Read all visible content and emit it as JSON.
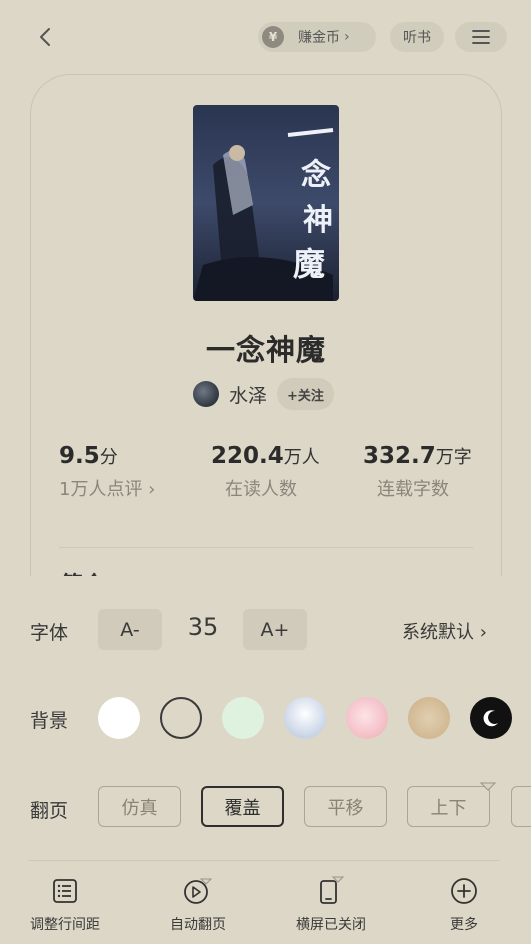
{
  "topbar": {
    "back_icon": "chevron-left-icon",
    "coin_label": "赚金币",
    "coin_chevron": "›",
    "listen_label": "听书",
    "menu_icon": "hamburger-icon"
  },
  "book": {
    "title": "一念神魔",
    "author": "水泽",
    "follow_label": "+关注",
    "stats": [
      {
        "value": "9.5",
        "unit": "分",
        "label": "1万人点评 ›"
      },
      {
        "value": "220.4",
        "unit": "万人",
        "label": "在读人数"
      },
      {
        "value": "332.7",
        "unit": "万字",
        "label": "连载字数"
      }
    ],
    "partial_section": "简介"
  },
  "settings": {
    "font": {
      "label": "字体",
      "decrease": "A-",
      "size": "35",
      "increase": "A+",
      "family": "系统默认 ›"
    },
    "background": {
      "label": "背景",
      "swatches": [
        "#ffffff",
        "transparent",
        "#dff2e0",
        "#dbe3ef",
        "#f6d1d6",
        "#d7c3a3",
        "#111111"
      ]
    },
    "paging": {
      "label": "翻页",
      "options": [
        "仿真",
        "覆盖",
        "平移",
        "上下"
      ],
      "selected": "覆盖"
    }
  },
  "toolbar": {
    "items": [
      {
        "label": "调整行间距",
        "icon": "line-spacing-icon"
      },
      {
        "label": "自动翻页",
        "icon": "auto-page-icon"
      },
      {
        "label": "横屏已关闭",
        "icon": "landscape-icon"
      },
      {
        "label": "更多",
        "icon": "plus-circle-icon"
      }
    ]
  }
}
